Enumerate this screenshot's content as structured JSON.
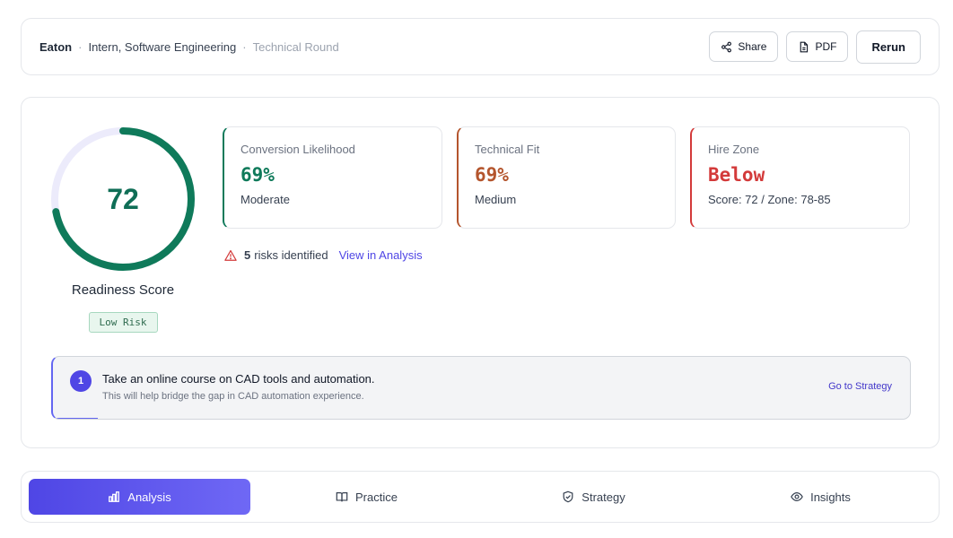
{
  "header": {
    "company": "Eaton",
    "separator": "·",
    "role": "Intern, Software Engineering",
    "round": "Technical Round",
    "share_label": "Share",
    "pdf_label": "PDF",
    "rerun_label": "Rerun"
  },
  "readiness": {
    "score": "72",
    "score_fraction": 0.72,
    "label": "Readiness Score",
    "risk_badge": "Low Risk",
    "colors": {
      "ring": "#0f7a5a",
      "track": "#ecebfb"
    }
  },
  "metrics": [
    {
      "label": "Conversion Likelihood",
      "value": "69%",
      "sub": "Moderate",
      "color": "#0f7a5a"
    },
    {
      "label": "Technical Fit",
      "value": "69%",
      "sub": "Medium",
      "color": "#b4552d"
    },
    {
      "label": "Hire Zone",
      "value": "Below",
      "sub": "Score: 72 / Zone: 78-85",
      "color": "#d33a3a"
    }
  ],
  "risks": {
    "count": "5",
    "text": "risks identified",
    "link": "View in Analysis",
    "icon": "warning-icon"
  },
  "next_action": {
    "number": "1",
    "title": "Take an online course on CAD tools and automation.",
    "subtitle": "This will help bridge the gap in CAD automation experience.",
    "link": "Go to Strategy"
  },
  "tabs": [
    {
      "label": "Analysis",
      "icon": "bar-chart-icon",
      "active": true
    },
    {
      "label": "Practice",
      "icon": "book-icon",
      "active": false
    },
    {
      "label": "Strategy",
      "icon": "shield-icon",
      "active": false
    },
    {
      "label": "Insights",
      "icon": "eye-icon",
      "active": false
    }
  ]
}
